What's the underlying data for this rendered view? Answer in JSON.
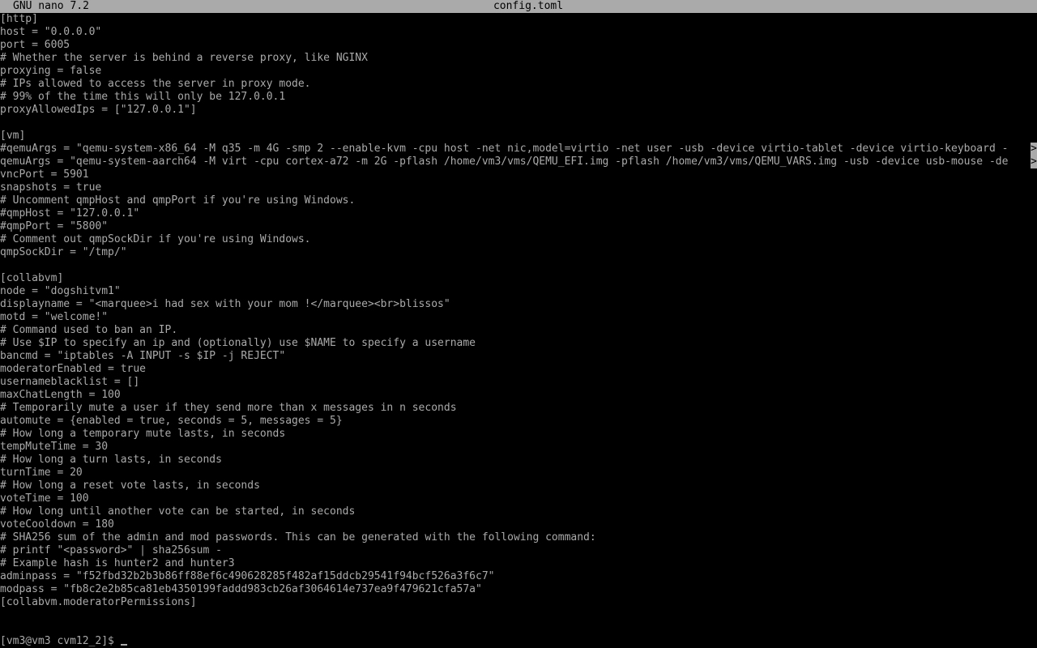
{
  "titlebar": {
    "app": "GNU nano 7.2",
    "file": "config.toml"
  },
  "lines": [
    {
      "text": "[http]"
    },
    {
      "text": "host = \"0.0.0.0\""
    },
    {
      "text": "port = 6005"
    },
    {
      "text": "# Whether the server is behind a reverse proxy, like NGINX"
    },
    {
      "text": "proxying = false"
    },
    {
      "text": "# IPs allowed to access the server in proxy mode."
    },
    {
      "text": "# 99% of the time this will only be 127.0.0.1"
    },
    {
      "text": "proxyAllowedIps = [\"127.0.0.1\"]"
    },
    {
      "text": ""
    },
    {
      "text": "[vm]"
    },
    {
      "text": "#qemuArgs = \"qemu-system-x86_64 -M q35 -m 4G -smp 2 --enable-kvm -cpu host -net nic,model=virtio -net user -usb -device virtio-tablet -device virtio-keyboard -",
      "overflow": ">"
    },
    {
      "text": "qemuArgs = \"qemu-system-aarch64 -M virt -cpu cortex-a72 -m 2G -pflash /home/vm3/vms/QEMU_EFI.img -pflash /home/vm3/vms/QEMU_VARS.img -usb -device usb-mouse -de",
      "overflow": ">"
    },
    {
      "text": "vncPort = 5901"
    },
    {
      "text": "snapshots = true"
    },
    {
      "text": "# Uncomment qmpHost and qmpPort if you're using Windows."
    },
    {
      "text": "#qmpHost = \"127.0.0.1\""
    },
    {
      "text": "#qmpPort = \"5800\""
    },
    {
      "text": "# Comment out qmpSockDir if you're using Windows."
    },
    {
      "text": "qmpSockDir = \"/tmp/\""
    },
    {
      "text": ""
    },
    {
      "text": "[collabvm]"
    },
    {
      "text": "node = \"dogshitvm1\""
    },
    {
      "text": "displayname = \"<marquee>i had sex with your mom !</marquee><br>blissos\""
    },
    {
      "text": "motd = \"welcome!\""
    },
    {
      "text": "# Command used to ban an IP."
    },
    {
      "text": "# Use $IP to specify an ip and (optionally) use $NAME to specify a username"
    },
    {
      "text": "bancmd = \"iptables -A INPUT -s $IP -j REJECT\""
    },
    {
      "text": "moderatorEnabled = true"
    },
    {
      "text": "usernameblacklist = []"
    },
    {
      "text": "maxChatLength = 100"
    },
    {
      "text": "# Temporarily mute a user if they send more than x messages in n seconds"
    },
    {
      "text": "automute = {enabled = true, seconds = 5, messages = 5}"
    },
    {
      "text": "# How long a temporary mute lasts, in seconds"
    },
    {
      "text": "tempMuteTime = 30"
    },
    {
      "text": "# How long a turn lasts, in seconds"
    },
    {
      "text": "turnTime = 20"
    },
    {
      "text": "# How long a reset vote lasts, in seconds"
    },
    {
      "text": "voteTime = 100"
    },
    {
      "text": "# How long until another vote can be started, in seconds"
    },
    {
      "text": "voteCooldown = 180"
    },
    {
      "text": "# SHA256 sum of the admin and mod passwords. This can be generated with the following command:"
    },
    {
      "text": "# printf \"<password>\" | sha256sum -"
    },
    {
      "text": "# Example hash is hunter2 and hunter3"
    },
    {
      "text": "adminpass = \"f52fbd32b2b3b86ff88ef6c490628285f482af15ddcb29541f94bcf526a3f6c7\""
    },
    {
      "text": "modpass = \"fb8c2e2b85ca81eb4350199faddd983cb26af3064614e737ea9f479621cfa57a\""
    },
    {
      "text": "[collabvm.moderatorPermissions]"
    }
  ],
  "prompt": {
    "text": "[vm3@vm3 cvm12_2]$"
  },
  "colors": {
    "background": "#000000",
    "foreground": "#aaaaaa",
    "titlebar_bg": "#aaaaaa",
    "titlebar_fg": "#000000"
  }
}
